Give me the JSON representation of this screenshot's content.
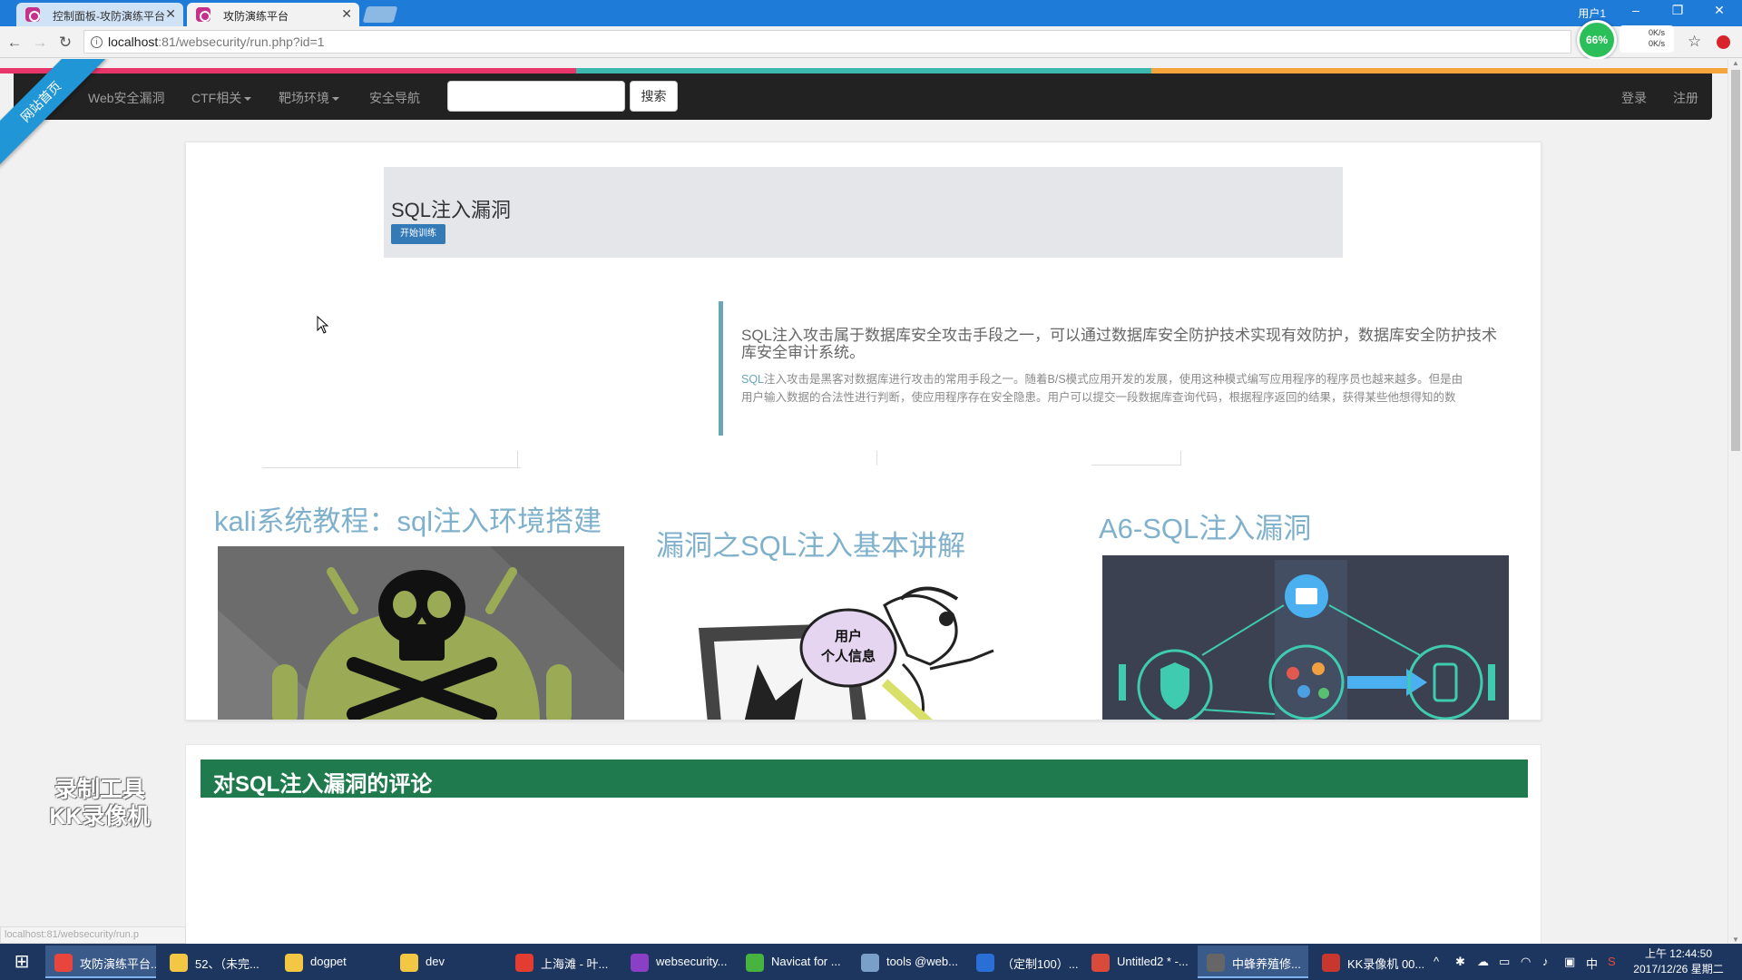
{
  "browser": {
    "tabs": [
      {
        "title": "控制面板-攻防演练平台"
      },
      {
        "title": "攻防演练平台"
      }
    ],
    "user": "用户1",
    "url_host": "localhost",
    "url_rest": ":81/websecurity/run.php?id=1",
    "perf_percent": "66%",
    "net_up": "0K/s",
    "net_down": "0K/s"
  },
  "colors": {
    "stripe": [
      "#e8366b",
      "#3cb8b0",
      "#f6a53c"
    ],
    "navbar_bg": "#222222",
    "ribbon": "#2196d6",
    "primary_button": "#337ab7",
    "comment_header": "#1f7a4e",
    "card_title": "#7fb0cc",
    "taskbar": "#1d3660"
  },
  "site": {
    "ribbon_label": "网站首页",
    "nav": [
      {
        "label": "Web安全漏洞",
        "dropdown": false
      },
      {
        "label": "CTF相关",
        "dropdown": true
      },
      {
        "label": "靶场环境",
        "dropdown": true
      },
      {
        "label": "安全导航",
        "dropdown": false
      }
    ],
    "search_placeholder": "",
    "search_button": "搜索",
    "login": "登录",
    "register": "注册"
  },
  "jumbotron": {
    "title": "SQL注入漏洞",
    "button": "开始训练"
  },
  "intro": {
    "lead_line1": "SQL注入攻击属于数据库安全攻击手段之一，可以通过数据库安全防护技术实现有效防护，数据库安全防护技术",
    "lead_line2": "库安全审计系统。",
    "body_accent": "SQL",
    "body_line1": "注入攻击是黑客对数据库进行攻击的常用手段之一。随着B/S模式应用开发的发展，使用这种模式编写应用程序的程序员也越来越多。但是由",
    "body_line2": "用户输入数据的合法性进行判断，使应用程序存在安全隐患。用户可以提交一段数据库查询代码，根据程序返回的结果，获得某些他想得知的数"
  },
  "cards": [
    {
      "title": "kali系统教程：sql注入环境搭建",
      "image": "android-skull-image"
    },
    {
      "title": "漏洞之SQL注入基本讲解",
      "image": "cartoon-thief-image",
      "image_text_line1": "用户",
      "image_text_line2": "个人信息"
    },
    {
      "title": "A6-SQL注入漏洞",
      "image": "security-flow-diagram-image"
    }
  ],
  "comments": {
    "header": "对SQL注入漏洞的评论"
  },
  "watermark": {
    "line1": "录制工具",
    "line2": "KK录像机"
  },
  "status_url": "localhost:81/websecurity/run.p",
  "taskbar": {
    "items": [
      {
        "label": "攻防演练平台...",
        "icon": "chrome-icon",
        "color": "#e8453c",
        "active": true
      },
      {
        "label": "52、（未完...",
        "icon": "folder-icon",
        "color": "#f3c744",
        "active": false
      },
      {
        "label": "dogpet",
        "icon": "folder-icon",
        "color": "#f3c744",
        "active": false
      },
      {
        "label": "dev",
        "icon": "folder-icon",
        "color": "#f3c744",
        "active": false
      },
      {
        "label": "上海滩 - 叶...",
        "icon": "music-player-icon",
        "color": "#e23d30",
        "active": false
      },
      {
        "label": "websecurity...",
        "icon": "phpstorm-icon",
        "color": "#8b3fc5",
        "active": false
      },
      {
        "label": "Navicat for ...",
        "icon": "navicat-icon",
        "color": "#46b43f",
        "active": false
      },
      {
        "label": "tools @web...",
        "icon": "ssh-tool-icon",
        "color": "#7aa0c9",
        "active": false
      },
      {
        "label": "（定制100）...",
        "icon": "document-icon",
        "color": "#2a6fd6",
        "active": false
      },
      {
        "label": "Untitled2 * -...",
        "icon": "pen-app-icon",
        "color": "#d94a3a",
        "active": false
      },
      {
        "label": "中蜂养殖修...",
        "icon": "image-viewer-icon",
        "color": "#666666",
        "active": true
      },
      {
        "label": "KK录像机 00...",
        "icon": "recorder-icon",
        "color": "#c8372d",
        "active": false
      }
    ],
    "tray_ime": "中",
    "time": "上午 12:44:50",
    "date": "2017/12/26 星期二"
  }
}
